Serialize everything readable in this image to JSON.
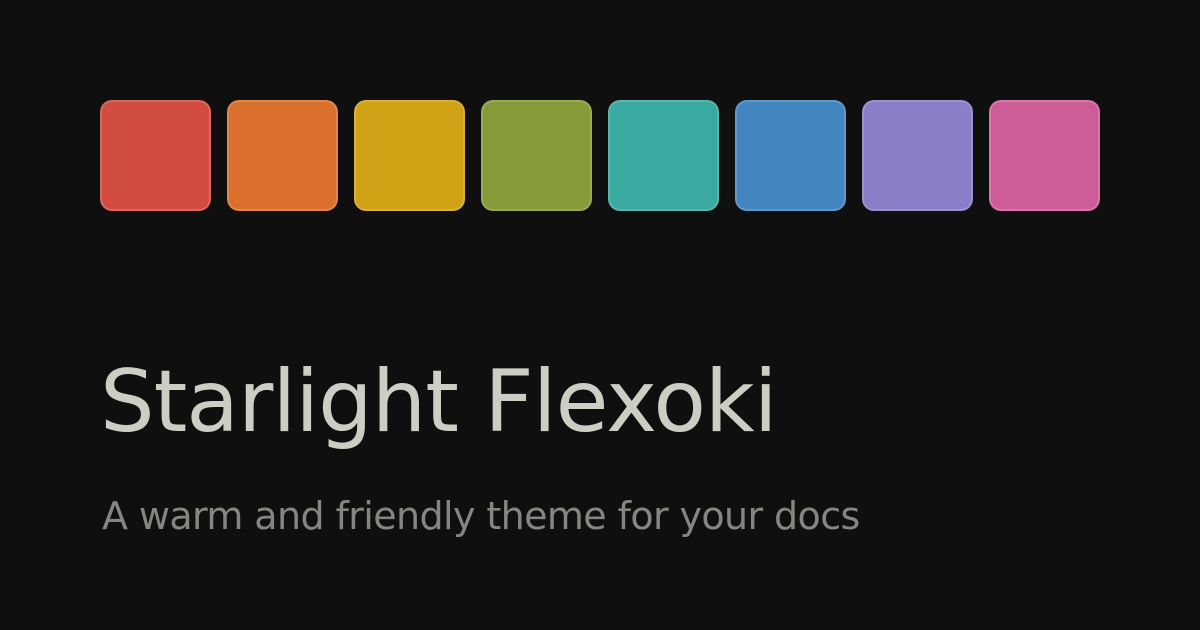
{
  "swatches": [
    {
      "name": "red",
      "color": "#d14d41"
    },
    {
      "name": "orange",
      "color": "#da702c"
    },
    {
      "name": "yellow",
      "color": "#d0a215"
    },
    {
      "name": "green",
      "color": "#879a39"
    },
    {
      "name": "cyan",
      "color": "#3aa99f"
    },
    {
      "name": "blue",
      "color": "#4385be"
    },
    {
      "name": "purple",
      "color": "#8b7ec8"
    },
    {
      "name": "magenta",
      "color": "#ce5d97"
    }
  ],
  "title": "Starlight Flexoki",
  "subtitle": "A warm and friendly theme for your docs",
  "colors": {
    "background": "#100f0f",
    "title": "#cecdc3",
    "subtitle": "#878580"
  }
}
